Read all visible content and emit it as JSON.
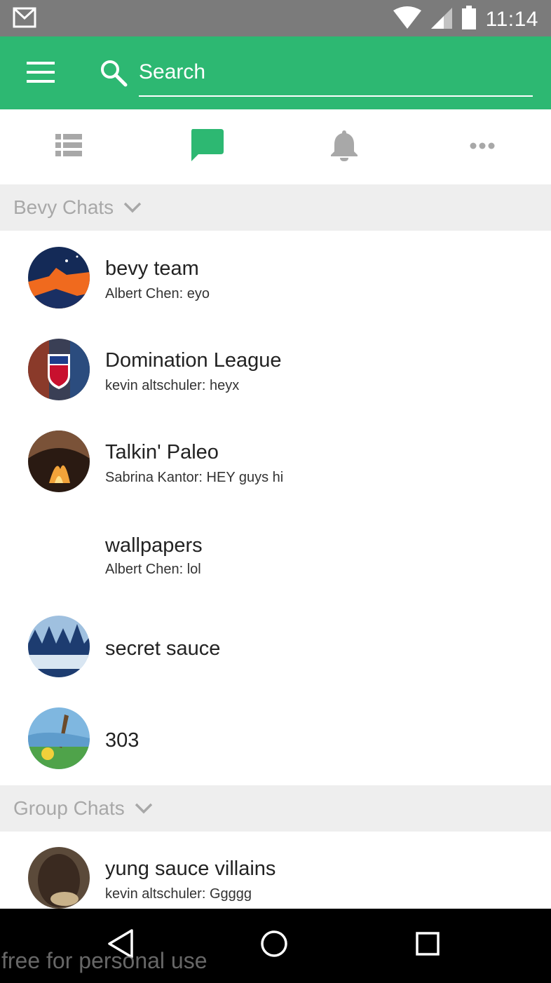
{
  "status_bar": {
    "time": "11:14"
  },
  "search": {
    "placeholder": "Search"
  },
  "tabs": [
    {
      "icon": "list-icon",
      "active": false
    },
    {
      "icon": "chat-bubble-icon",
      "active": true
    },
    {
      "icon": "bell-icon",
      "active": false
    },
    {
      "icon": "more-icon",
      "active": false
    }
  ],
  "colors": {
    "accent": "#2db872",
    "status_bar": "#7b7b7b",
    "section_bg": "#eeeeee",
    "inactive_icon": "#a8a8a8"
  },
  "sections": [
    {
      "label": "Bevy Chats",
      "chats": [
        {
          "name": "bevy team",
          "preview": "Albert Chen: eyo"
        },
        {
          "name": "Domination League",
          "preview": "kevin altschuler: heyx"
        },
        {
          "name": "Talkin' Paleo",
          "preview": "Sabrina Kantor: HEY guys hi"
        },
        {
          "name": "wallpapers",
          "preview": "Albert Chen: lol"
        },
        {
          "name": "secret sauce",
          "preview": ""
        },
        {
          "name": "303",
          "preview": ""
        }
      ]
    },
    {
      "label": "Group Chats",
      "chats": [
        {
          "name": "yung sauce villains",
          "preview": "kevin altschuler: Ggggg"
        }
      ]
    }
  ],
  "watermark": "free for personal use"
}
